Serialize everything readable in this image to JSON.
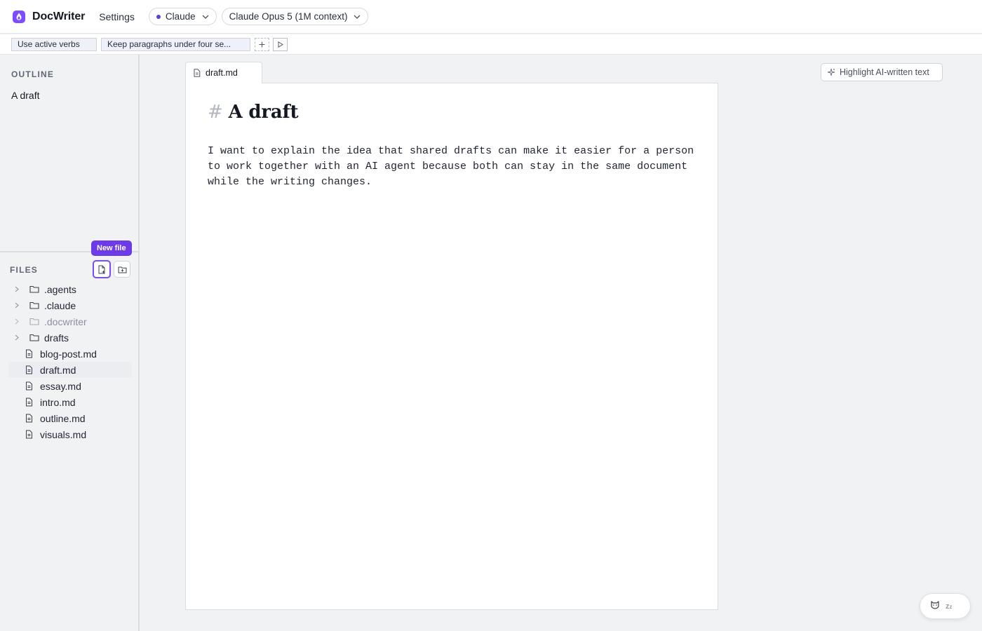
{
  "app": {
    "title": "DocWriter",
    "settings_label": "Settings",
    "accent_color": "#7c4dff"
  },
  "header": {
    "provider": {
      "label": "Claude",
      "icon": "status-dot-icon"
    },
    "model": {
      "label": "Claude Opus 5 (1M context)"
    }
  },
  "rules": {
    "items": [
      {
        "label": "Use active verbs"
      },
      {
        "label": "Keep paragraphs under four se..."
      }
    ],
    "add_icon": "plus-icon",
    "run_icon": "play-icon"
  },
  "sidebar": {
    "outline_label": "OUTLINE",
    "outline_items": [
      {
        "label": "A draft"
      }
    ],
    "files_label": "FILES",
    "new_file_tooltip": "New file",
    "files": [
      {
        "name": ".agents",
        "type": "folder"
      },
      {
        "name": ".claude",
        "type": "folder"
      },
      {
        "name": ".docwriter",
        "type": "folder",
        "muted": true
      },
      {
        "name": "drafts",
        "type": "folder"
      },
      {
        "name": "blog-post.md",
        "type": "file"
      },
      {
        "name": "draft.md",
        "type": "file",
        "active": true
      },
      {
        "name": "essay.md",
        "type": "file"
      },
      {
        "name": "intro.md",
        "type": "file"
      },
      {
        "name": "outline.md",
        "type": "file"
      },
      {
        "name": "visuals.md",
        "type": "file"
      }
    ]
  },
  "editor": {
    "tab_label": "draft.md",
    "heading_marker": "#",
    "heading": "A draft",
    "body": "I want to explain the idea that shared drafts can make it easier for a person\nto work together with an AI agent because both can stay in the same document\nwhile the writing changes.",
    "highlight_button_label": "Highlight AI-written text"
  },
  "assistant": {
    "sleep_label": "z",
    "sleep_label_small": "z"
  }
}
